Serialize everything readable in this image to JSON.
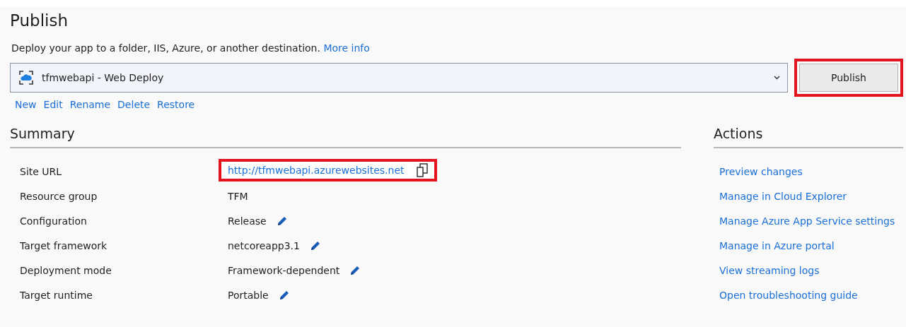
{
  "title": "Publish",
  "description": {
    "text": "Deploy your app to a folder, IIS, Azure, or another destination.",
    "link": "More info"
  },
  "profile": {
    "value": "tfmwebapi - Web Deploy"
  },
  "publish_button": {
    "label": "Publish",
    "highlighted": true
  },
  "profile_actions": [
    "New",
    "Edit",
    "Rename",
    "Delete",
    "Restore"
  ],
  "summary": {
    "heading": "Summary",
    "rows": [
      {
        "label": "Site URL",
        "value": "http://tfmwebapi.azurewebsites.net",
        "kind": "link",
        "highlighted": true
      },
      {
        "label": "Resource group",
        "value": "TFM",
        "kind": "text"
      },
      {
        "label": "Configuration",
        "value": "Release",
        "kind": "editable"
      },
      {
        "label": "Target framework",
        "value": "netcoreapp3.1",
        "kind": "editable"
      },
      {
        "label": "Deployment mode",
        "value": "Framework-dependent",
        "kind": "editable"
      },
      {
        "label": "Target runtime",
        "value": "Portable",
        "kind": "editable"
      }
    ]
  },
  "actions": {
    "heading": "Actions",
    "links": [
      "Preview changes",
      "Manage in Cloud Explorer",
      "Manage Azure App Service settings",
      "Manage in Azure portal",
      "View streaming logs",
      "Open troubleshooting guide"
    ]
  }
}
